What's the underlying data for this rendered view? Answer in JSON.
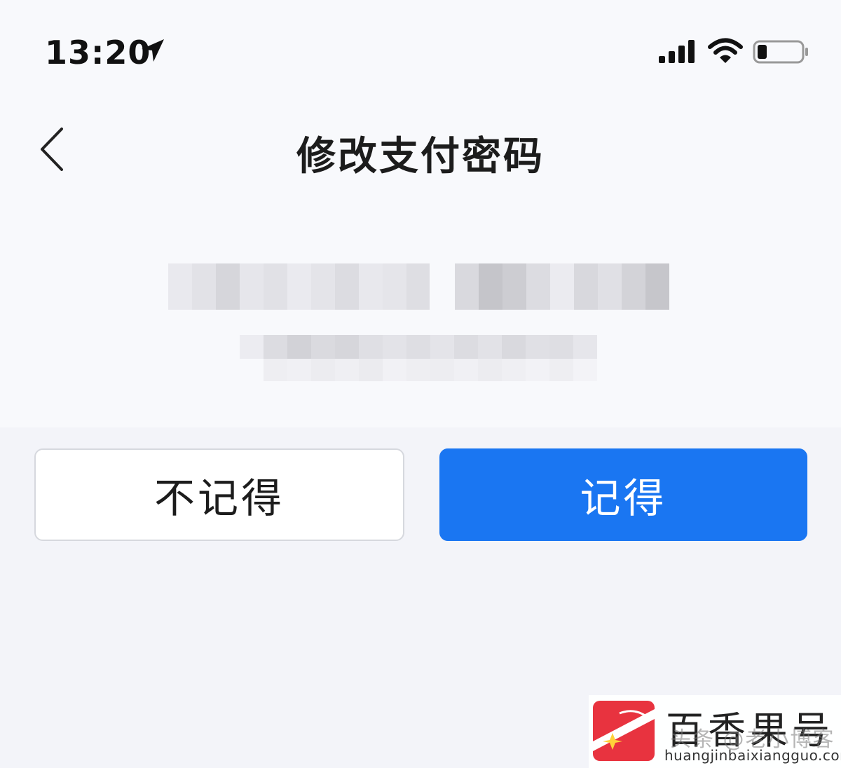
{
  "status_bar": {
    "time": "13:20",
    "icons": [
      "location-arrow-icon",
      "cellular-signal-icon",
      "wifi-icon",
      "battery-icon"
    ]
  },
  "nav": {
    "back_icon": "chevron-left-icon",
    "title": "修改支付密码"
  },
  "redacted_info": {
    "note": "",
    "lines": 2
  },
  "actions": {
    "forget_label": "不记得",
    "remember_label": "记得"
  },
  "colors": {
    "primary": "#1a76f2",
    "background": "#f3f4f9",
    "top_background": "#f8f9fc"
  },
  "watermark": {
    "brand": "百香果号",
    "overlay": "头条 @老小博客",
    "url": "huangjinbaixiangguo.com"
  }
}
